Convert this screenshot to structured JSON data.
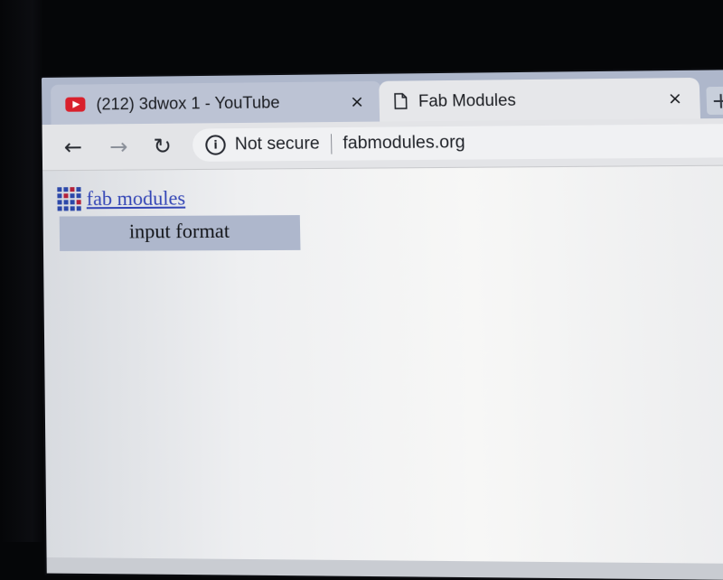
{
  "tabs": [
    {
      "title": "(212) 3dwox 1 - YouTube",
      "favicon": "youtube-icon",
      "active": false,
      "close_label": "×"
    },
    {
      "title": "Fab Modules",
      "favicon": "page-icon",
      "active": true,
      "close_label": "×"
    }
  ],
  "new_tab_label": "+",
  "toolbar": {
    "back_icon": "back-arrow-icon",
    "forward_icon": "forward-arrow-icon",
    "reload_icon": "reload-icon",
    "security_text": "Not secure",
    "url": "fabmodules.org"
  },
  "page": {
    "logo_icon": "fab-logo-icon",
    "title_link": "fab modules",
    "input_format_label": "input format"
  },
  "colors": {
    "tab_strip": "#aeb7cb",
    "link": "#3446b6",
    "input_format_bg": "#aeb7cc"
  }
}
